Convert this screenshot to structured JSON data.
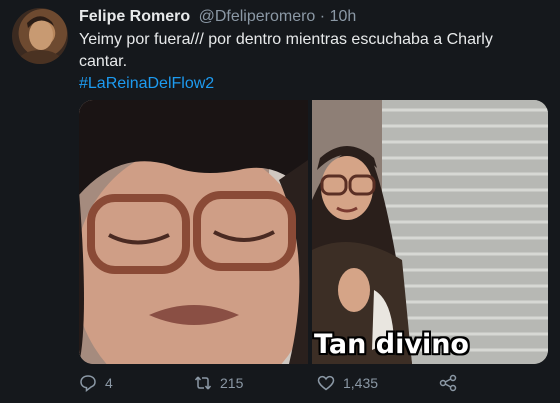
{
  "tweet": {
    "author_name": "Felipe  Romero",
    "handle": "@Dfeliperomero",
    "separator": "·",
    "time": "10h",
    "text": "Yeimy por fuera/// por dentro mientras escuchaba a Charly cantar.",
    "hashtag": "#LaReinaDelFlow2",
    "media_caption": "Tan divino"
  },
  "actions": {
    "reply_count": "4",
    "retweet_count": "215",
    "like_count": "1,435"
  },
  "colors": {
    "background": "#15181c",
    "accent": "#1d9bf0",
    "muted": "#8b98a5"
  }
}
